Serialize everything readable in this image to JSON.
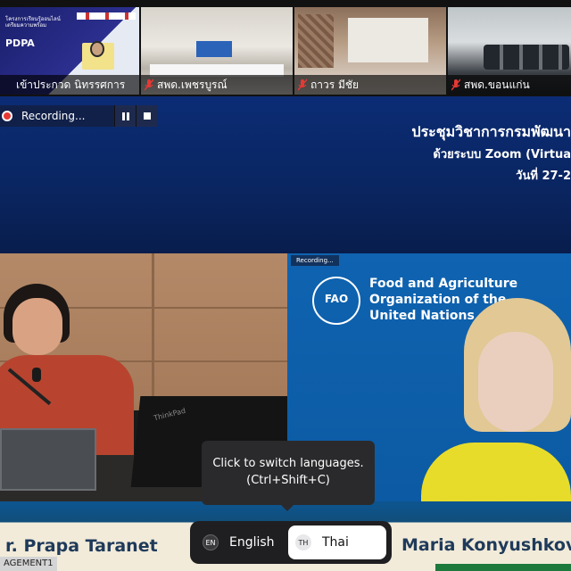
{
  "participants": [
    {
      "name": "เข้าประกวด นิทรรศการ",
      "muted": false,
      "slide": {
        "title": "โครงการเรียนรู้ออนไลน์ เตรียมความพร้อม",
        "tag": "PDPA"
      }
    },
    {
      "name": "สพด.เพชรบูรณ์",
      "muted": true
    },
    {
      "name": "ถาวร มีชัย",
      "muted": true
    },
    {
      "name": "สพด.ขอนแก่น",
      "muted": true
    }
  ],
  "recording": {
    "label": "Recording...",
    "pause_icon": "pause-icon",
    "stop_icon": "stop-icon"
  },
  "banner": {
    "title": "ประชุมวิชาการกรมพัฒนา",
    "subtitle": "ด้วยระบบ Zoom (Virtua",
    "date": "วันที่ 27-2"
  },
  "left_video": {
    "laptop_brand": "ThinkPad"
  },
  "right_video": {
    "mini_recording": "Recording...",
    "logo_text": "FAO",
    "org_lines": [
      "Food and Agriculture",
      "Organization of the",
      "United Nations"
    ]
  },
  "tooltip": {
    "line1": "Click to switch languages.",
    "line2": "(Ctrl+Shift+C)"
  },
  "name_bar": {
    "left_name": "r. Prapa Taranet",
    "right_name": "Maria Konyushkov",
    "corner_tag": "AGEMENT1"
  },
  "language_switcher": {
    "options": [
      {
        "code": "EN",
        "label": "English",
        "selected": false
      },
      {
        "code": "TH",
        "label": "Thai",
        "selected": true
      }
    ]
  },
  "colors": {
    "banner_bg": "#0b2c75",
    "fao_blue": "#0f63b0",
    "recording_red": "#e53935",
    "accent_yellow": "#e8dc2a"
  }
}
